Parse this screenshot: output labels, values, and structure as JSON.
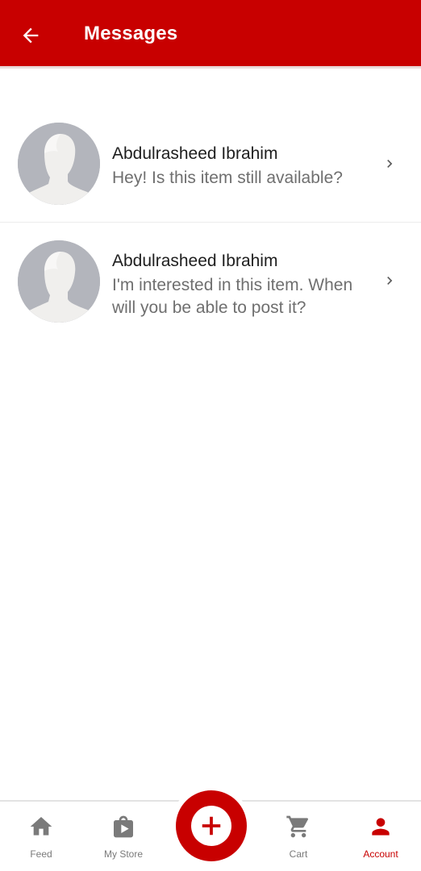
{
  "header": {
    "title": "Messages",
    "back_icon": "arrow-left-icon"
  },
  "messages": [
    {
      "sender": "Abdulrasheed Ibrahim",
      "preview": "Hey! Is this item still available?",
      "avatar_icon": "default-avatar-icon"
    },
    {
      "sender": "Abdulrasheed Ibrahim",
      "preview": "I'm interested in this item. When will you be able to post it?",
      "avatar_icon": "default-avatar-icon"
    }
  ],
  "nav": {
    "items": [
      {
        "label": "Feed",
        "icon": "home-icon",
        "active": false
      },
      {
        "label": "My Store",
        "icon": "store-bag-icon",
        "active": false
      },
      {
        "label": "Cart",
        "icon": "cart-icon",
        "active": false
      },
      {
        "label": "Account",
        "icon": "person-icon",
        "active": true
      }
    ],
    "fab_icon": "plus-icon"
  },
  "colors": {
    "brand": "#c80000",
    "text_primary": "#1e1e1e",
    "text_secondary": "#6f6f6f",
    "nav_inactive": "#7a7a7a"
  }
}
